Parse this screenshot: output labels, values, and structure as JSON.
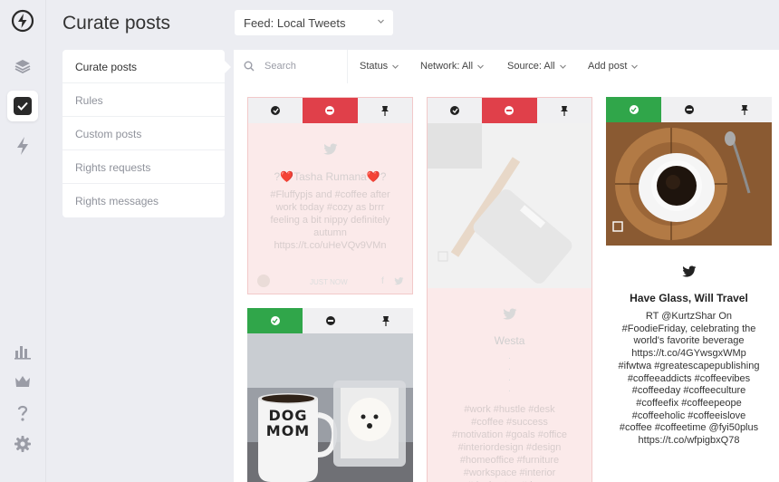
{
  "page": {
    "title": "Curate posts"
  },
  "feed": {
    "label": "Feed: Local Tweets"
  },
  "submenu": {
    "items": [
      "Curate posts",
      "Rules",
      "Custom posts",
      "Rights requests",
      "Rights messages"
    ]
  },
  "filters": {
    "search_placeholder": "Search",
    "status": "Status",
    "network": "Network: All",
    "source": "Source: All",
    "add_post": "Add post"
  },
  "cards": [
    {
      "state": "rejected",
      "author": "?❤️Tasha Rumana❤️?",
      "text": "#Fluffypjs and #coffee after work today #cozy as brrr feeling a bit nippy definitely autumn https://t.co/uHeVQv9VMn",
      "time": "JUST NOW"
    },
    {
      "state": "rejected",
      "author": "Westa",
      "text": "#work #hustle #desk #coffee #success #motivation #goals #office #interiordesign #design #homeoffice #furniture #workspace #interior #desksetup #decor"
    },
    {
      "state": "approved",
      "author": "Have Glass, Will Travel",
      "text": "RT @KurtzShar On #FoodieFriday, celebrating the world's favorite beverage https://t.co/4GYwsgxWMp #ifwtwa #greatescapepublishing #coffeeaddicts #coffeevibes #coffeeday #coffeeculture #coffeefix #coffeepeope #coffeeholic #coffeeislove #coffee #coffeetime @fyi50plus https://t.co/wfpigbxQ78"
    },
    {
      "state": "approved",
      "mug_text": "DOG MOM"
    }
  ],
  "colors": {
    "approve": "#30a64a",
    "reject": "#e0404a",
    "rejected_bg": "#fbeaea"
  }
}
